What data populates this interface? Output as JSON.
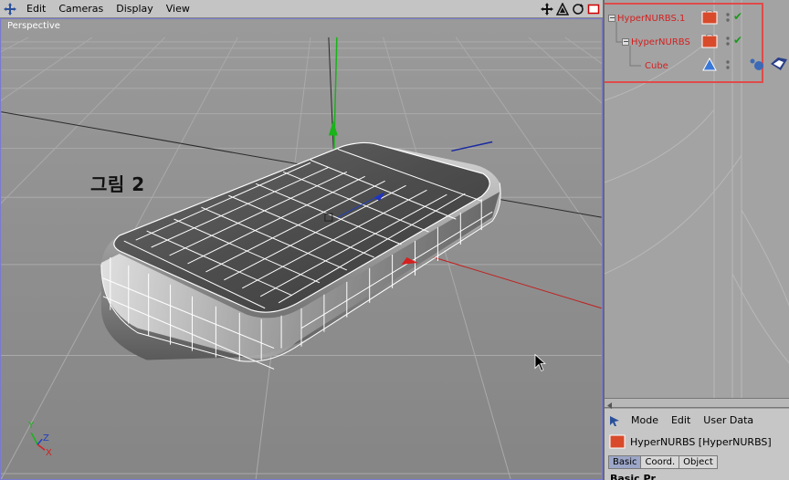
{
  "viewport": {
    "menu": [
      "Edit",
      "Cameras",
      "Display",
      "View"
    ],
    "label": "Perspective",
    "caption": "그림 2",
    "axis_labels": {
      "y": "Y",
      "z": "Z",
      "x": "X"
    }
  },
  "objects": [
    {
      "name": "HyperNURBS.1",
      "checked": true
    },
    {
      "name": "HyperNURBS",
      "checked": true
    },
    {
      "name": "Cube",
      "checked": false
    }
  ],
  "attributes": {
    "menu": [
      "Mode",
      "Edit",
      "User Data"
    ],
    "title": "HyperNURBS [HyperNURBS]",
    "tabs": [
      "Basic",
      "Coord.",
      "Object"
    ],
    "active_tab": "Basic",
    "section": "Basic Pr"
  },
  "colors": {
    "selection_box": "#e04a4a",
    "object_text": "#d42020",
    "check": "#1a9a1a",
    "y_axis": "#18b418",
    "x_axis": "#d42020",
    "z_axis": "#2040c0"
  }
}
